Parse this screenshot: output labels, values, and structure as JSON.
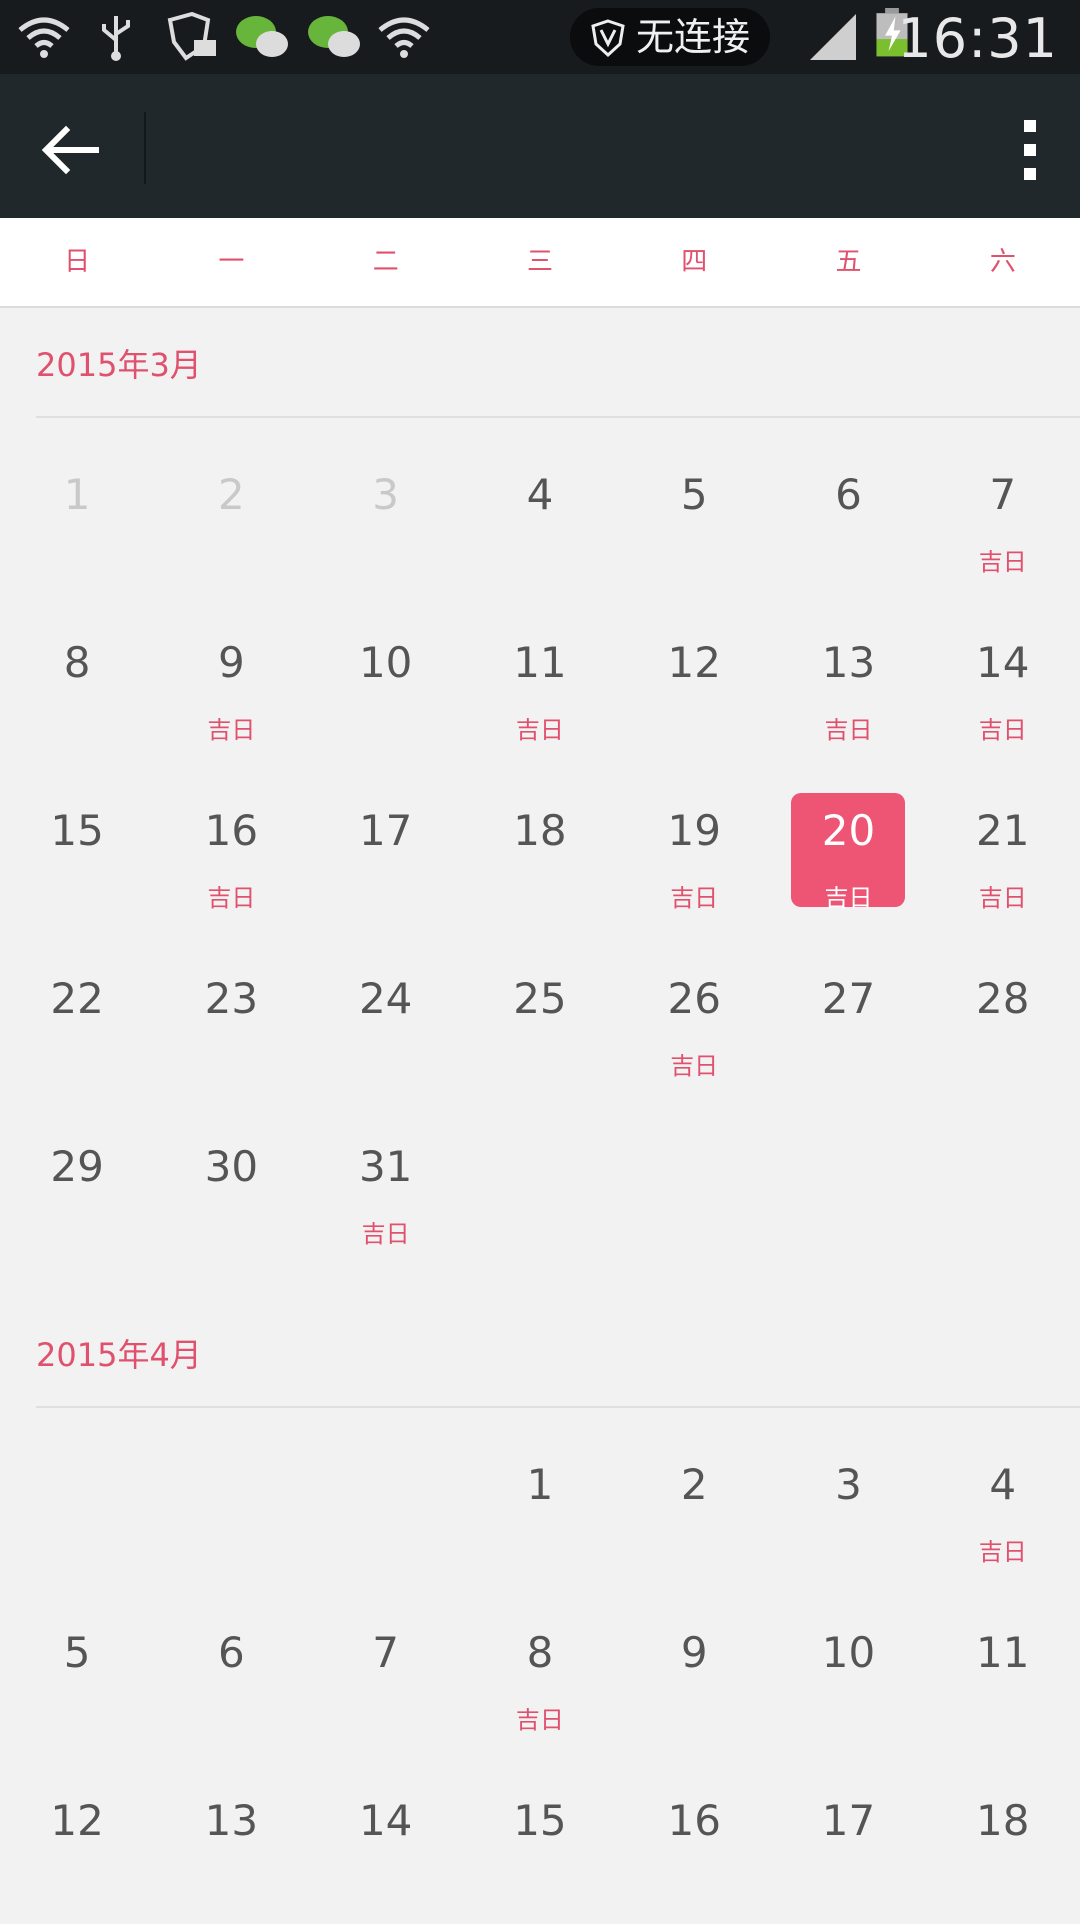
{
  "status_bar": {
    "vpn_text": "无连接",
    "time": "16:31",
    "icons": [
      "wifi-question-icon",
      "usb-icon",
      "shield-mail-icon",
      "wechat-icon",
      "wechat-icon",
      "wifi-question-icon",
      "signal-icon",
      "battery-charging-icon"
    ]
  },
  "app_bar": {
    "icons": [
      "back-arrow-icon",
      "more-vert-icon"
    ]
  },
  "weekdays": [
    "日",
    "一",
    "二",
    "三",
    "四",
    "五",
    "六"
  ],
  "colors": {
    "accent": "#e0516d",
    "selected_bg": "#ee5575",
    "app_bar": "#21282b"
  },
  "auspicious_label": "吉日",
  "months": [
    {
      "title": "2015年3月",
      "weeks": [
        [
          {
            "n": "1",
            "dim": true
          },
          {
            "n": "2",
            "dim": true
          },
          {
            "n": "3",
            "dim": true
          },
          {
            "n": "4"
          },
          {
            "n": "5"
          },
          {
            "n": "6"
          },
          {
            "n": "7",
            "tag": "吉日"
          }
        ],
        [
          {
            "n": "8"
          },
          {
            "n": "9",
            "tag": "吉日"
          },
          {
            "n": "10"
          },
          {
            "n": "11",
            "tag": "吉日"
          },
          {
            "n": "12"
          },
          {
            "n": "13",
            "tag": "吉日"
          },
          {
            "n": "14",
            "tag": "吉日"
          }
        ],
        [
          {
            "n": "15"
          },
          {
            "n": "16",
            "tag": "吉日"
          },
          {
            "n": "17"
          },
          {
            "n": "18"
          },
          {
            "n": "19",
            "tag": "吉日"
          },
          {
            "n": "20",
            "tag": "吉日",
            "selected": true
          },
          {
            "n": "21",
            "tag": "吉日"
          }
        ],
        [
          {
            "n": "22"
          },
          {
            "n": "23"
          },
          {
            "n": "24"
          },
          {
            "n": "25"
          },
          {
            "n": "26",
            "tag": "吉日"
          },
          {
            "n": "27"
          },
          {
            "n": "28"
          }
        ],
        [
          {
            "n": "29"
          },
          {
            "n": "30"
          },
          {
            "n": "31",
            "tag": "吉日"
          },
          null,
          null,
          null,
          null
        ]
      ]
    },
    {
      "title": "2015年4月",
      "weeks": [
        [
          null,
          null,
          null,
          {
            "n": "1"
          },
          {
            "n": "2"
          },
          {
            "n": "3"
          },
          {
            "n": "4",
            "tag": "吉日"
          }
        ],
        [
          {
            "n": "5"
          },
          {
            "n": "6"
          },
          {
            "n": "7"
          },
          {
            "n": "8",
            "tag": "吉日"
          },
          {
            "n": "9"
          },
          {
            "n": "10"
          },
          {
            "n": "11"
          }
        ],
        [
          {
            "n": "12"
          },
          {
            "n": "13"
          },
          {
            "n": "14"
          },
          {
            "n": "15"
          },
          {
            "n": "16"
          },
          {
            "n": "17"
          },
          {
            "n": "18"
          }
        ]
      ]
    }
  ]
}
